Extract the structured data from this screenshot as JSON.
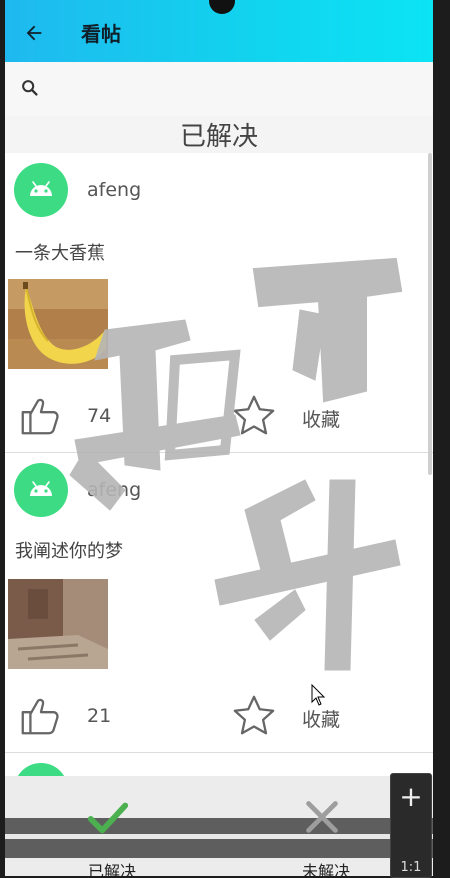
{
  "appbar": {
    "title": "看帖",
    "back_icon": "arrow-left-icon"
  },
  "search": {
    "icon": "search-icon",
    "value": "",
    "placeholder": ""
  },
  "section": {
    "title": "已解决"
  },
  "posts": [
    {
      "username": "afeng",
      "text": "一条大香蕉",
      "image": "banana-photo",
      "likes": "74",
      "favorite_label": "收藏"
    },
    {
      "username": "afeng",
      "text": "我阐述你的梦",
      "image": "stone-steps-photo",
      "likes": "21",
      "favorite_label": "收藏"
    }
  ],
  "bottom_nav": {
    "tabs": [
      {
        "label": "已解决",
        "icon": "checkmark-icon",
        "color": "#4caf50"
      },
      {
        "label": "未解决",
        "icon": "close-icon",
        "color": "#9e9e9e"
      }
    ]
  },
  "zoom": {
    "plus": "+",
    "ratio": "1:1"
  },
  "colors": {
    "appbar_start": "#1fb9ef",
    "appbar_end": "#0be4f4",
    "avatar": "#3ddc84"
  }
}
